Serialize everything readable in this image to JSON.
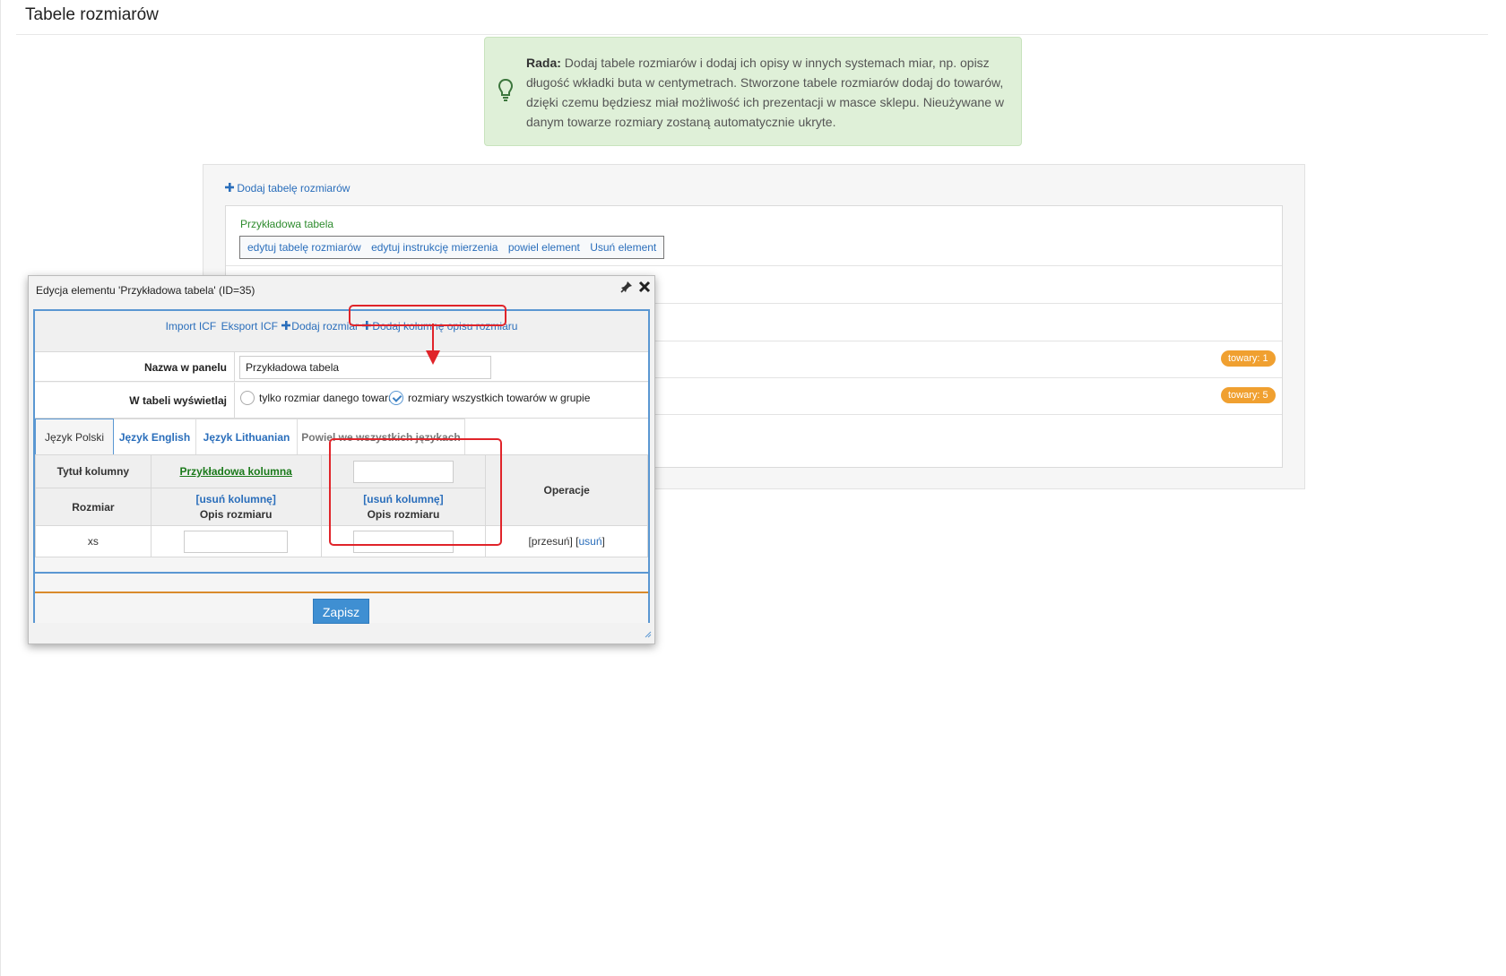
{
  "page": {
    "title": "Tabele rozmiarów"
  },
  "tip": {
    "label": "Rada:",
    "text": "Dodaj tabele rozmiarów i dodaj ich opisy w innych systemach miar, np. opisz długość wkładki buta w centymetrach. Stworzone tabele rozmiarów dodaj do towarów, dzięki czemu będziesz miał możliwość ich prezentacji w masce sklepu. Nieużywane w danym towarze rozmiary zostaną automatycznie ukryte."
  },
  "list": {
    "add_link": "Dodaj tabelę rozmiarów",
    "element_name": "Przykładowa tabela",
    "actions": [
      "edytuj tabelę rozmiarów",
      "edytuj instrukcję mierzenia",
      "powiel element",
      "Usuń element"
    ],
    "badges": [
      "towary: 1",
      "towary: 5"
    ]
  },
  "dialog": {
    "title": "Edycja elementu 'Przykładowa tabela' (ID=35)",
    "top_links": {
      "import": "Import ICF",
      "export": "Eksport ICF",
      "add_size": "Dodaj rozmiar",
      "add_column": "Dodaj kolumnę opisu rozmiaru"
    },
    "name_label": "Nazwa w panelu",
    "name_value": "Przykładowa tabela",
    "display_label": "W tabeli wyświetlaj",
    "display_options": [
      "tylko rozmiar danego towaru",
      "rozmiary wszystkich towarów w grupie"
    ],
    "display_selected": "rozmiary wszystkich towarów w grupie",
    "tabs": [
      "Język Polski",
      "Język English",
      "Język Lithuanian",
      "Powiel we wszystkich językach"
    ],
    "active_tab": "Język Polski",
    "table": {
      "col_title_label": "Tytuł kolumny",
      "col1_title": "Przykładowa kolumna",
      "size_header": "Rozmiar",
      "remove_column": "[usuń kolumnę]",
      "desc_header": "Opis rozmiaru",
      "ops_header": "Operacje",
      "rows": [
        {
          "size": "xs",
          "move": "[przesuń]",
          "remove_open": "[",
          "remove": "usuń",
          "remove_close": "]"
        }
      ]
    },
    "save_label": "Zapisz"
  },
  "colors": {
    "accent": "#3f8fd2",
    "tip_bg": "#dff0d8",
    "badge": "#f0a030",
    "annotation": "#e0242a",
    "orange_rule": "#d98a2b"
  }
}
